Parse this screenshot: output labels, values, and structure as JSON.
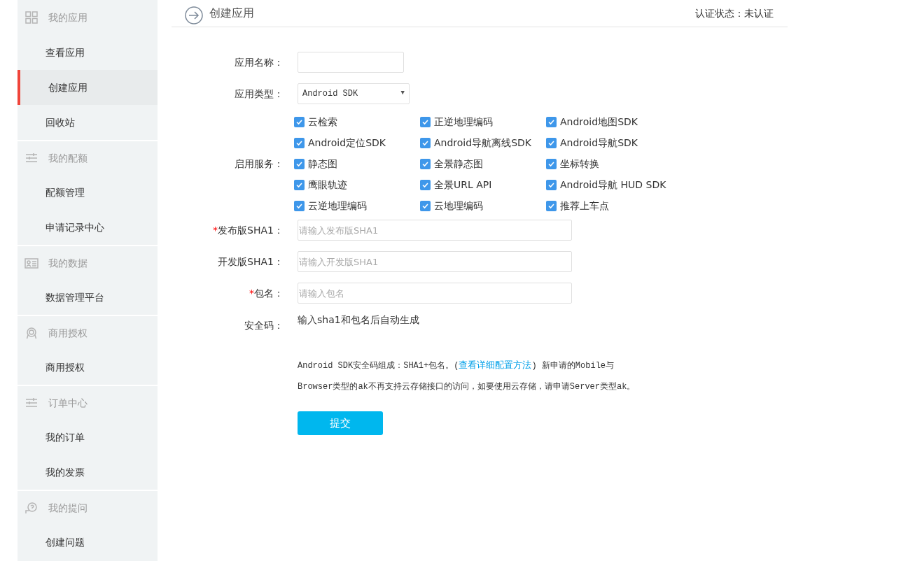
{
  "sidebar": {
    "groups": [
      {
        "title": "我的应用",
        "items": [
          {
            "label": "查看应用",
            "selected": false
          },
          {
            "label": "创建应用",
            "selected": true
          },
          {
            "label": "回收站",
            "selected": false
          }
        ]
      },
      {
        "title": "我的配额",
        "items": [
          {
            "label": "配额管理",
            "selected": false
          },
          {
            "label": "申请记录中心",
            "selected": false
          }
        ]
      },
      {
        "title": "我的数据",
        "items": [
          {
            "label": "数据管理平台",
            "selected": false
          }
        ]
      },
      {
        "title": "商用授权",
        "items": [
          {
            "label": "商用授权",
            "selected": false
          }
        ]
      },
      {
        "title": "订单中心",
        "items": [
          {
            "label": "我的订单",
            "selected": false
          },
          {
            "label": "我的发票",
            "selected": false
          }
        ]
      },
      {
        "title": "我的提问",
        "items": [
          {
            "label": "创建问题",
            "selected": false
          }
        ]
      }
    ]
  },
  "header": {
    "title": "创建应用",
    "status": "认证状态：未认证"
  },
  "form": {
    "app_name": {
      "label": "应用名称："
    },
    "app_type": {
      "label": "应用类型：",
      "value": "Android SDK",
      "arrow": "▼"
    },
    "services": {
      "label": "启用服务：",
      "options": [
        {
          "label": "云检索",
          "checked": true
        },
        {
          "label": "正逆地理编码",
          "checked": true
        },
        {
          "label": "Android地图SDK",
          "checked": true
        },
        {
          "label": "Android定位SDK",
          "checked": true
        },
        {
          "label": "Android导航离线SDK",
          "checked": true
        },
        {
          "label": "Android导航SDK",
          "checked": true
        },
        {
          "label": "静态图",
          "checked": true
        },
        {
          "label": "全景静态图",
          "checked": true
        },
        {
          "label": "坐标转换",
          "checked": true
        },
        {
          "label": "鹰眼轨迹",
          "checked": true
        },
        {
          "label": "全景URL API",
          "checked": true
        },
        {
          "label": "Android导航 HUD SDK",
          "checked": true
        },
        {
          "label": "云逆地理编码",
          "checked": true
        },
        {
          "label": "云地理编码",
          "checked": true
        },
        {
          "label": "推荐上车点",
          "checked": true
        }
      ]
    },
    "fields": [
      {
        "required_mark": "*",
        "label": "发布版SHA1：",
        "placeholder": "请输入发布版SHA1"
      },
      {
        "label": "开发版SHA1：",
        "placeholder": "请输入开发版SHA1"
      },
      {
        "required_mark": "*",
        "label": "包名：",
        "placeholder": "请输入包名"
      }
    ],
    "security_code": {
      "label": "安全码：",
      "value": "输入sha1和包名后自动生成"
    },
    "note": {
      "before": "Android SDK安全码组成：SHA1+包名。(",
      "link": "查看详细配置方法",
      "after": ") 新申请的Mobile与Browser类型的ak不再支持云存储接口的访问，如要使用云存储，请申请Server类型ak。"
    },
    "submit": "提交"
  }
}
